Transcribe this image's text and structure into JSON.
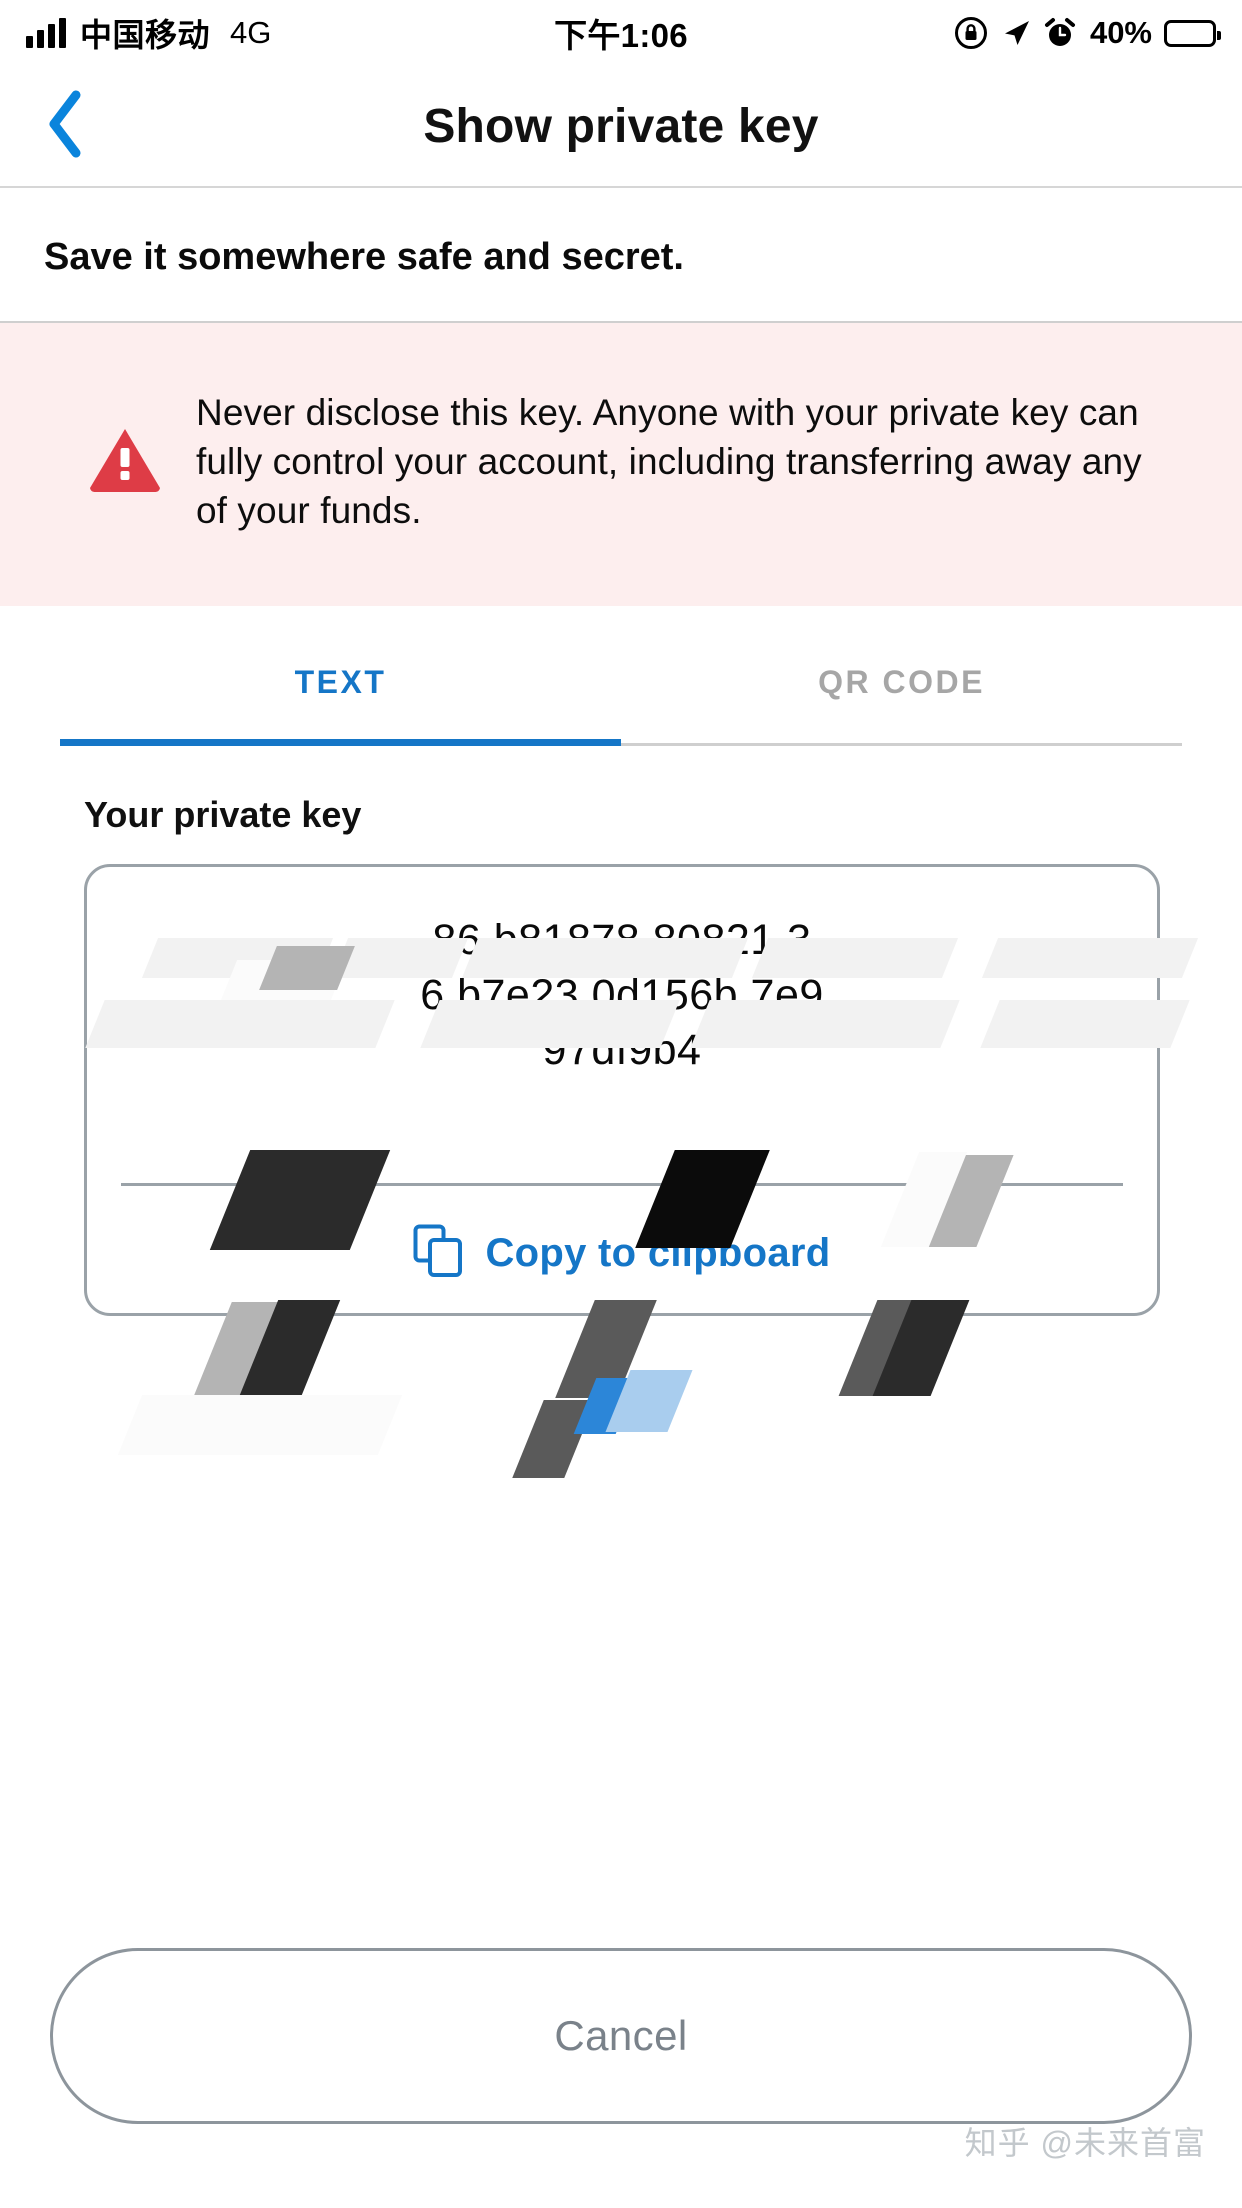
{
  "status_bar": {
    "carrier": "中国移动",
    "network": "4G",
    "time": "下午1:06",
    "battery_percent": "40%",
    "icons": [
      "signal-bars-icon",
      "rotation-lock-icon",
      "location-arrow-icon",
      "alarm-clock-icon",
      "battery-icon"
    ]
  },
  "navbar": {
    "back_icon": "chevron-left-icon",
    "title": "Show private key"
  },
  "subtitle": "Save it somewhere safe and secret.",
  "warning": {
    "icon": "warning-triangle-icon",
    "icon_color": "#de3c46",
    "background_color": "#fdeeee",
    "text": "Never disclose this key. Anyone with your private key can fully control your account, including transferring away any of your funds."
  },
  "tabs": [
    {
      "label": "TEXT",
      "active": true
    },
    {
      "label": "QR CODE",
      "active": false
    }
  ],
  "key_section": {
    "label": "Your private key",
    "key_line_1": "86        b81878    80821      3",
    "key_line_2": "6     b7e23     0d156b     7e9",
    "key_line_3": "97df9b4",
    "copy_icon": "copy-documents-icon",
    "copy_label": "Copy to clipboard"
  },
  "cancel": {
    "label": "Cancel"
  },
  "watermark": "知乎 @未来首富",
  "colors": {
    "accent_blue": "#1576c7",
    "warning_red": "#de3c46",
    "warning_bg": "#fdeeee",
    "muted_gray": "#7a828a"
  }
}
